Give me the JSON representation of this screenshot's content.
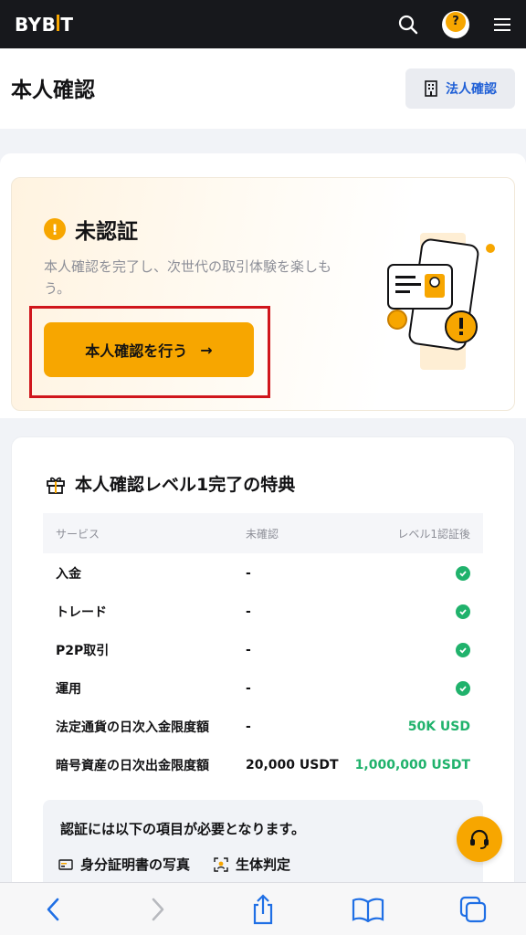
{
  "brand": {
    "logo_left": "BYB",
    "logo_right": "T",
    "accent": "#f7a600"
  },
  "header": {
    "title": "本人確認",
    "corp_button": "法人確認"
  },
  "status": {
    "label": "未認証",
    "description": "本人確認を完了し、次世代の取引体験を楽しもう。",
    "button": "本人確認を行う",
    "button_arrow": "→"
  },
  "benefits": {
    "title": "本人確認レベル1完了の特典",
    "columns": [
      "サービス",
      "未確認",
      "レベル1認証後"
    ],
    "rows": [
      {
        "service": "入金",
        "unverified": "-",
        "level1": "check"
      },
      {
        "service": "トレード",
        "unverified": "-",
        "level1": "check"
      },
      {
        "service": "P2P取引",
        "unverified": "-",
        "level1": "check"
      },
      {
        "service": "運用",
        "unverified": "-",
        "level1": "check"
      },
      {
        "service": "法定通貨の日次入金限度額",
        "unverified": "-",
        "level1": "50K USD"
      },
      {
        "service": "暗号資産の日次出金限度額",
        "unverified": "20,000 USDT",
        "level1": "1,000,000 USDT"
      }
    ]
  },
  "requirements": {
    "title": "認証には以下の項目が必要となります。",
    "items": [
      {
        "icon": "id-card-icon",
        "label": "身分証明書の写真"
      },
      {
        "icon": "face-scan-icon",
        "label": "生体判定"
      }
    ]
  },
  "browser_nav": [
    "back-icon",
    "forward-icon",
    "share-icon",
    "bookmarks-icon",
    "tabs-icon"
  ]
}
